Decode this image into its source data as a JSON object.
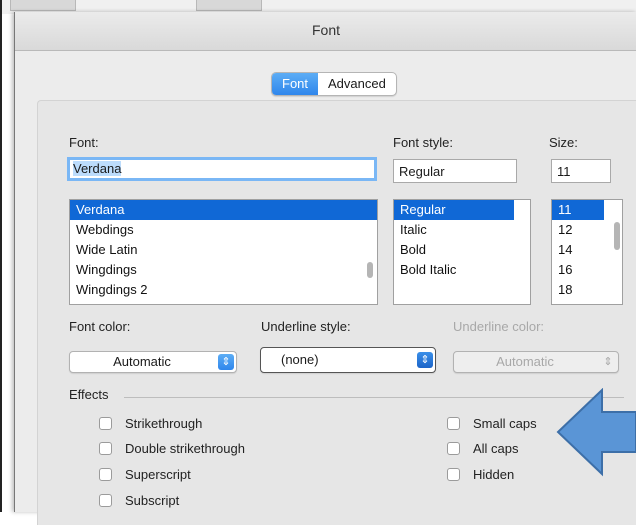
{
  "window": {
    "title": "Font"
  },
  "tabs": [
    {
      "label": "Font",
      "active": true
    },
    {
      "label": "Advanced",
      "active": false
    }
  ],
  "font_section": {
    "font_label": "Font:",
    "font_value": "Verdana",
    "style_label": "Font style:",
    "style_value": "Regular",
    "size_label": "Size:",
    "size_value": "11"
  },
  "font_list": [
    "Verdana",
    "Webdings",
    "Wide Latin",
    "Wingdings",
    "Wingdings 2"
  ],
  "style_list": [
    "Regular",
    "Italic",
    "Bold",
    "Bold Italic"
  ],
  "size_list": [
    "11",
    "12",
    "14",
    "16",
    "18"
  ],
  "color_row": {
    "font_color_label": "Font color:",
    "font_color_value": "Automatic",
    "underline_style_label": "Underline style:",
    "underline_style_value": "(none)",
    "underline_color_label": "Underline color:",
    "underline_color_value": "Automatic"
  },
  "effects": {
    "label": "Effects",
    "left": [
      "Strikethrough",
      "Double strikethrough",
      "Superscript",
      "Subscript"
    ],
    "right": [
      "Small caps",
      "All caps",
      "Hidden"
    ]
  },
  "colors": {
    "accent": "#2f86ec",
    "selection": "#1068d6",
    "annotation_arrow": "#5a95d6"
  },
  "icons": {
    "popup_arrow": "updown-chevron-icon",
    "annotation": "arrow-left-icon"
  }
}
